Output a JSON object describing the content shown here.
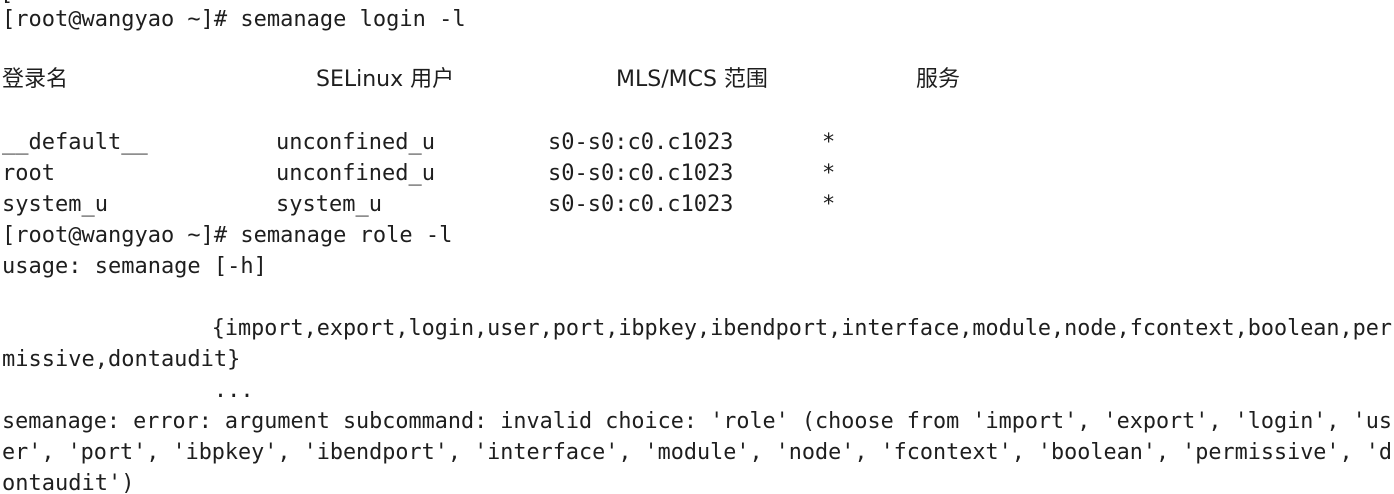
{
  "terminal": {
    "partial_top_line": "[",
    "prompt1": "[root@wangyao ~]# semanage login -l",
    "login_table": {
      "headers": [
        "登录名",
        "SELinux 用户",
        "MLS/MCS 范围",
        "服务"
      ],
      "rows": [
        [
          "__default__",
          "unconfined_u",
          "s0-s0:c0.c1023",
          "*"
        ],
        [
          "root",
          "unconfined_u",
          "s0-s0:c0.c1023",
          "*"
        ],
        [
          "system_u",
          "system_u",
          "s0-s0:c0.c1023",
          "*"
        ]
      ]
    },
    "prompt2": "[root@wangyao ~]# semanage role -l",
    "usage": "usage: semanage [-h]",
    "subcommands_line1": "                {import,export,login,user,port,ibpkey,ibendport,interface,module,node,fcontext,boolean,per",
    "subcommands_line2": "missive,dontaudit}",
    "ellipsis": "                ...",
    "error_line1": "semanage: error: argument subcommand: invalid choice: 'role' (choose from 'import', 'export', 'login', 'us",
    "error_line2": "er', 'port', 'ibpkey', 'ibendport', 'interface', 'module', 'node', 'fcontext', 'boolean', 'permissive', 'd",
    "error_line3": "ontaudit')"
  }
}
